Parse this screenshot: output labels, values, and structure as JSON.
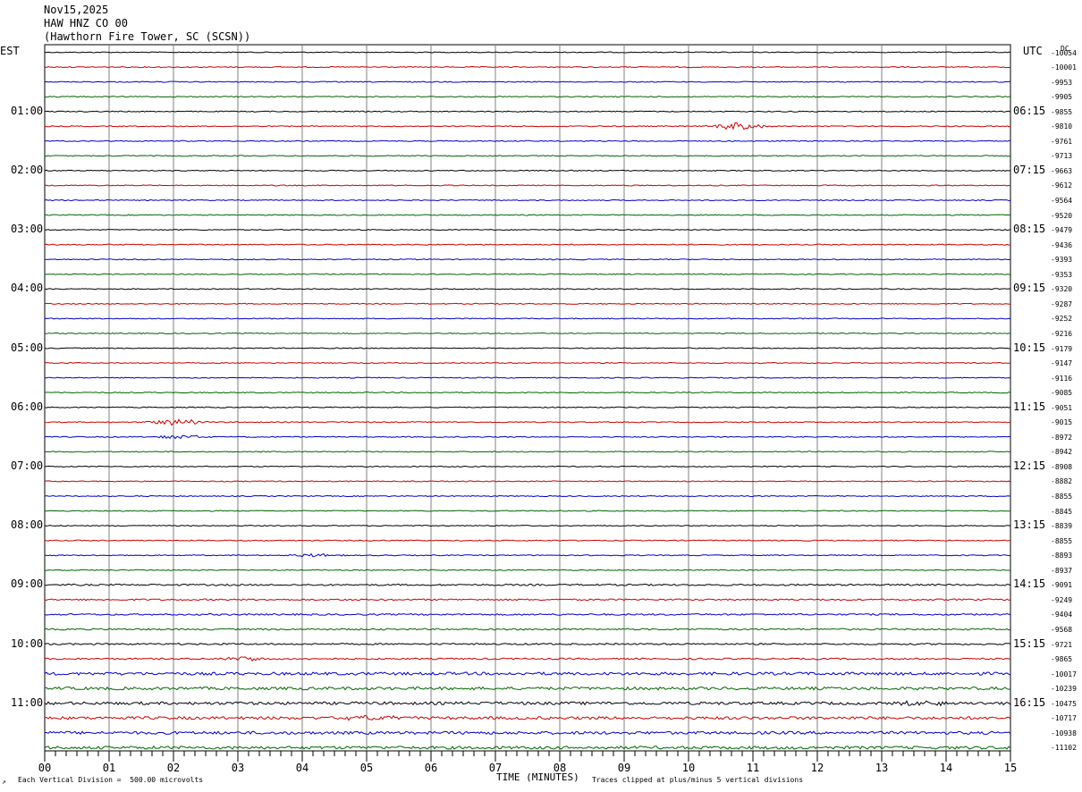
{
  "header": {
    "date": "Nov15,2025",
    "station": "HAW HNZ CO 00",
    "location": "(Hawthorn Fire Tower, SC (SCSN))"
  },
  "left_timezone": "EST",
  "right_timezone": "UTC",
  "dc_label": "DC",
  "footer": {
    "scale_note": "Each Vertical Division =  500.00 microvolts",
    "clip_note": "Traces clipped at plus/minus 5 vertical divisions",
    "x_axis_label": "TIME (MINUTES)",
    "corner_mark": "↗"
  },
  "colors": {
    "trace_cycle": [
      "#000000",
      "#cc0000",
      "#0000cc",
      "#006600"
    ],
    "grid": "#808080"
  },
  "chart_data": {
    "type": "line",
    "title": "",
    "xlabel": "TIME (MINUTES)",
    "xlim": [
      0,
      15
    ],
    "x_ticks": [
      "00",
      "01",
      "02",
      "03",
      "04",
      "05",
      "06",
      "07",
      "08",
      "09",
      "10",
      "11",
      "12",
      "13",
      "14",
      "15"
    ],
    "left_hour_labels": [
      "01:00",
      "02:00",
      "03:00",
      "04:00",
      "05:00",
      "06:00",
      "07:00",
      "08:00",
      "09:00",
      "10:00",
      "11:00"
    ],
    "right_hour_labels": [
      "06:15",
      "07:15",
      "08:15",
      "09:15",
      "10:15",
      "11:15",
      "12:15",
      "13:15",
      "14:15",
      "15:15",
      "16:15"
    ],
    "trace_count": 48,
    "dc_offsets": [
      "-10054",
      "-10001",
      "-9953",
      "-9905",
      "-9855",
      "-9810",
      "-9761",
      "-9713",
      "-9663",
      "-9612",
      "-9564",
      "-9520",
      "-9479",
      "-9436",
      "-9393",
      "-9353",
      "-9320",
      "-9287",
      "-9252",
      "-9216",
      "-9179",
      "-9147",
      "-9116",
      "-9085",
      "-9051",
      "-9015",
      "-8972",
      "-8942",
      "-8908",
      "-8882",
      "-8855",
      "-8845",
      "-8839",
      "-8855",
      "-8893",
      "-8937",
      "-9091",
      "-9249",
      "-9404",
      "-9568",
      "-9721",
      "-9865",
      "-10017",
      "-10239",
      "-10475",
      "-10717",
      "-10938",
      "-11102"
    ],
    "events": [
      {
        "trace": 5,
        "minute": 10.75,
        "amplitude": 0.8
      },
      {
        "trace": 25,
        "minute": 2.05,
        "amplitude": 0.7
      },
      {
        "trace": 26,
        "minute": 2.1,
        "amplitude": 0.4
      },
      {
        "trace": 34,
        "minute": 4.2,
        "amplitude": 0.35
      },
      {
        "trace": 41,
        "minute": 3.1,
        "amplitude": 0.6
      },
      {
        "trace": 44,
        "minute": 13.7,
        "amplitude": 0.5
      },
      {
        "trace": 45,
        "minute": 5.1,
        "amplitude": 0.5
      }
    ],
    "noise_level_by_trace_group": "higher noise in final 6 traces (10:30-11:45 EST)"
  }
}
